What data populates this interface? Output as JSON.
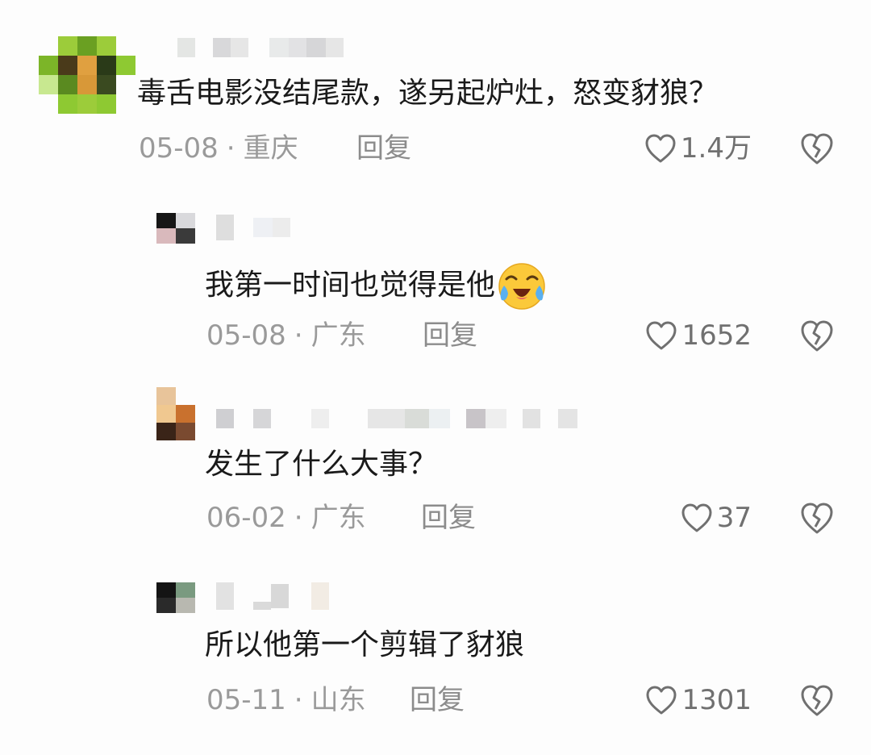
{
  "comments": [
    {
      "text": "毒舌电影没结尾款，遂另起炉灶，怒变豺狼？",
      "date": "05-08",
      "location": "重庆",
      "reply_label": "回复",
      "likes": "1.4万"
    },
    {
      "text": "我第一时间也觉得是他",
      "emoji": "crying-laughing-emoji",
      "date": "05-08",
      "location": "广东",
      "reply_label": "回复",
      "likes": "1652"
    },
    {
      "text": "发生了什么大事？",
      "date": "06-02",
      "location": "广东",
      "reply_label": "回复",
      "likes": "37"
    },
    {
      "text": "所以他第一个剪辑了豺狼",
      "date": "05-11",
      "location": "山东",
      "reply_label": "回复",
      "likes": "1301"
    }
  ],
  "separator": "·",
  "icons": {
    "like": "heart-outline-icon",
    "dislike": "broken-heart-icon"
  },
  "colors": {
    "text": "#1a1a1a",
    "meta": "#9a9a9a",
    "icon": "#707070"
  }
}
